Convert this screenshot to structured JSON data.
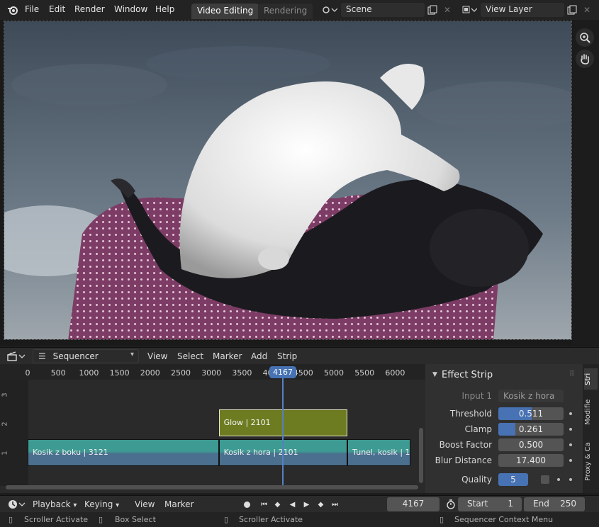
{
  "topbar": {
    "menus": [
      "File",
      "Edit",
      "Render",
      "Window",
      "Help"
    ],
    "workspace_tabs": [
      "Video Editing",
      "Rendering"
    ],
    "scene": "Scene",
    "view_layer": "View Layer"
  },
  "sequencer_header": {
    "editor_type": "Sequencer",
    "menus": [
      "View",
      "Select",
      "Marker",
      "Add",
      "Strip"
    ]
  },
  "timeline": {
    "ruler_ticks": [
      "0",
      "500",
      "1000",
      "1500",
      "2000",
      "2500",
      "3000",
      "3500",
      "4000",
      "4500",
      "5000",
      "5500",
      "6000"
    ],
    "current_frame": "4167",
    "channels": [
      "1",
      "2",
      "3"
    ],
    "strips": [
      {
        "label": "Kosik z boku | 3121",
        "channel": 1,
        "start": 0,
        "end": 3121,
        "type": "movie"
      },
      {
        "label": "Kosik z hora | 2101",
        "channel": 1,
        "start": 3121,
        "end": 5222,
        "type": "movie"
      },
      {
        "label": "Tunel, kosik | 1",
        "channel": 1,
        "start": 5222,
        "end": 6250,
        "type": "movie"
      },
      {
        "label": "Glow | 2101",
        "channel": 2,
        "start": 3121,
        "end": 5222,
        "type": "effect"
      }
    ]
  },
  "effect_strip": {
    "title": "Effect Strip",
    "input1_label": "Input 1",
    "input1_value": "Kosik z hora",
    "threshold_label": "Threshold",
    "threshold": "0.511",
    "threshold_fill": 0.511,
    "clamp_label": "Clamp",
    "clamp": "0.261",
    "clamp_fill": 0.261,
    "boost_label": "Boost Factor",
    "boost": "0.500",
    "blur_label": "Blur Distance",
    "blur": "17.400",
    "quality_label": "Quality",
    "quality": "5"
  },
  "side_tabs": [
    "Stri",
    "Modifie",
    "Proxy & Ca"
  ],
  "playback": {
    "menus": [
      "Playback",
      "Keying",
      "View",
      "Marker"
    ],
    "current_frame": "4167",
    "start_label": "Start",
    "start": "1",
    "end_label": "End",
    "end": "250"
  },
  "status": {
    "items": [
      "Scroller Activate",
      "Box Select",
      "Scroller Activate",
      "Sequencer Context Menu"
    ]
  },
  "colors": {
    "accent_blue": "#4772b3",
    "movie_strip": "#3e9b93",
    "effect_strip": "#6e7c21",
    "playhead": "#5680c2"
  }
}
